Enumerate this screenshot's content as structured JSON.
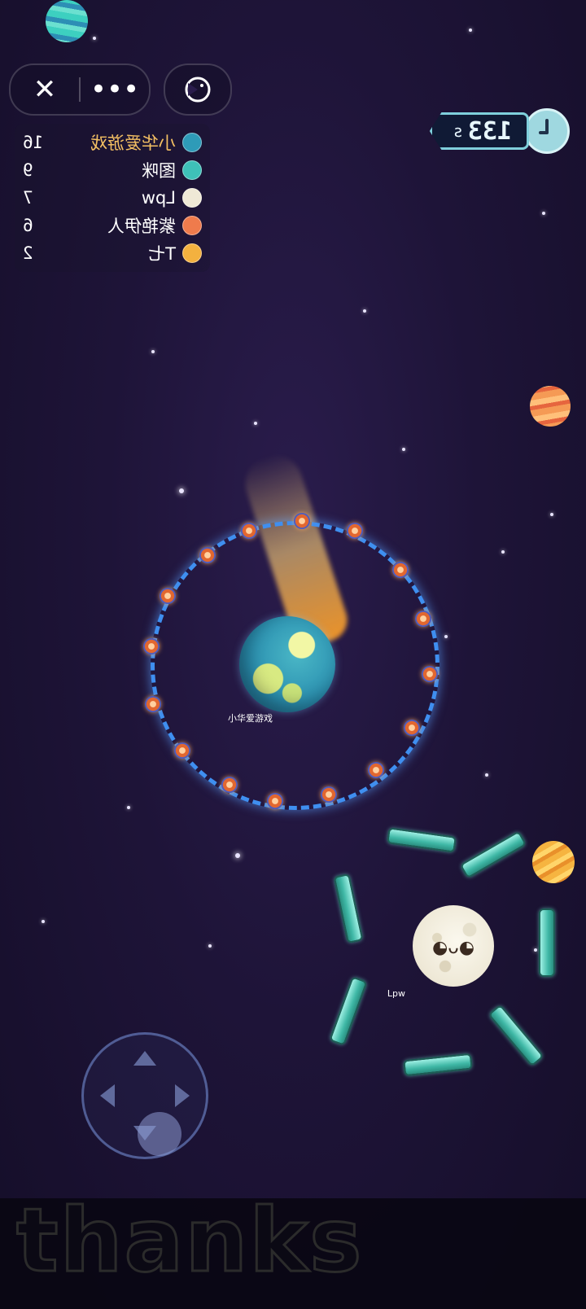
{
  "timer": {
    "value": "133",
    "unit": "s"
  },
  "menu": {
    "close_icon": "close-icon",
    "more_icon": "more-icon",
    "game_icon": "pacman-face-icon"
  },
  "leaderboard": [
    {
      "name": "小华爱游戏",
      "score": "16",
      "color": "#2e9bb8"
    },
    {
      "name": "图咪",
      "score": "9",
      "color": "#3ec1b8"
    },
    {
      "name": "Lpw",
      "score": "7",
      "color": "#efe9d6"
    },
    {
      "name": "紫艳伊人",
      "score": "6",
      "color": "#ef7b4c"
    },
    {
      "name": "T七",
      "score": "2",
      "color": "#f3b13f"
    }
  ],
  "players": {
    "earth_tag": "小华爱游戏",
    "moon_tag": "Lpw"
  },
  "caption": "thanks"
}
